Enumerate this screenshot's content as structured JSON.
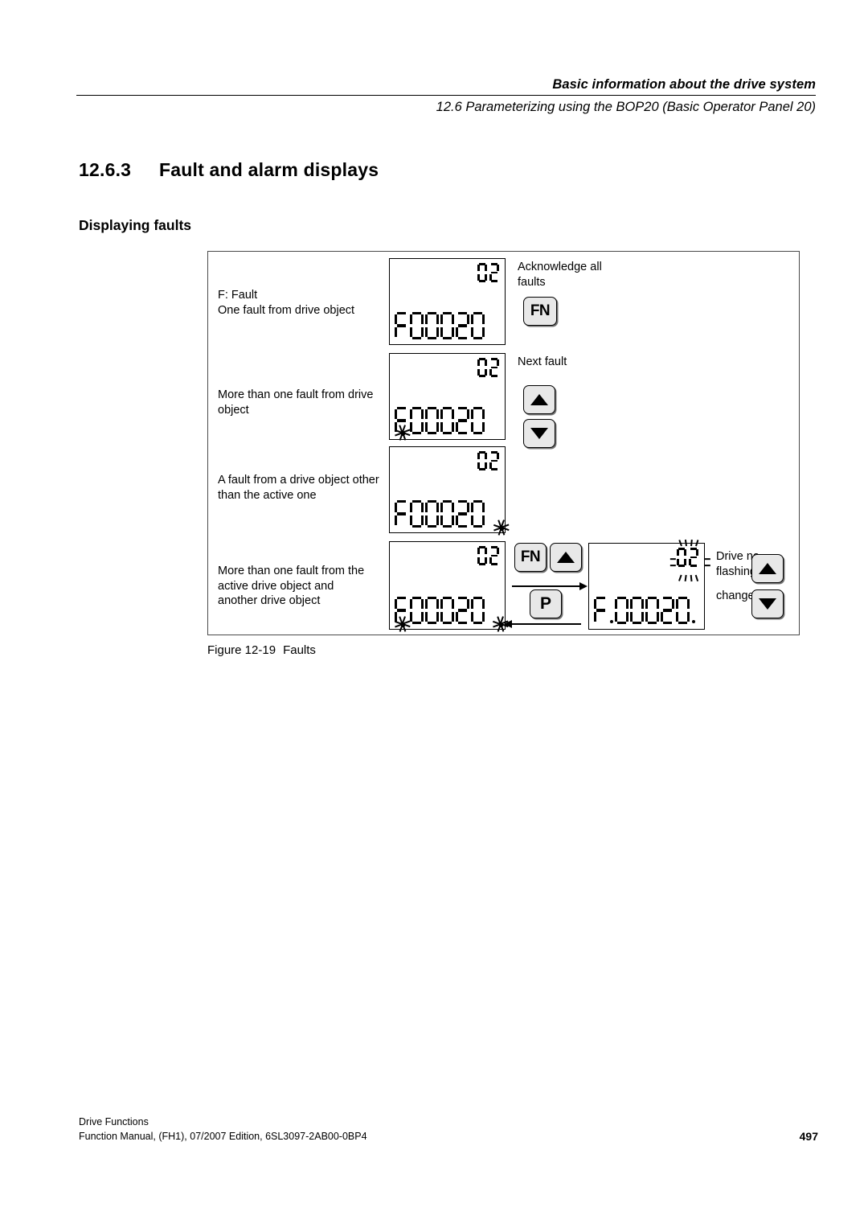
{
  "header": {
    "line1": "Basic information about the drive system",
    "line2": "12.6 Parameterizing using the BOP20 (Basic Operator Panel 20)"
  },
  "section": {
    "number": "12.6.3",
    "title": "Fault and alarm displays",
    "subtitle": "Displaying faults"
  },
  "figure": {
    "caption_label": "Figure 12-19",
    "caption_text": "Faults",
    "rows": [
      {
        "label_line1": "F: Fault",
        "label_line2": "One fault from drive object",
        "display_small": "02",
        "display_main": "F00020",
        "note_line1": "Acknowledge all",
        "note_line2": "faults",
        "keys": [
          "FN"
        ]
      },
      {
        "label_line1": "More than one fault from drive",
        "label_line2": "object",
        "display_small": "02",
        "display_main": "F00020",
        "note_line1": "Next fault",
        "note_line2": "",
        "keys": [
          "up",
          "down"
        ]
      },
      {
        "label_line1": "A fault from a drive object other",
        "label_line2": "than the active one",
        "display_small": "02",
        "display_main": "F00020",
        "note_line1": "",
        "note_line2": "",
        "keys": []
      },
      {
        "label_line1": "More than one fault from the",
        "label_line2": "active drive object and",
        "label_line3": "another drive object",
        "display_small": "02",
        "display_main": "F00020",
        "display2_small": "02",
        "display2_main": "F00020",
        "note_line1": "Drive no.",
        "note_line2": "flashing",
        "note_line3": "change",
        "keys_mid": [
          "FN",
          "up",
          "P"
        ],
        "keys_right": [
          "up",
          "down"
        ]
      }
    ]
  },
  "footer": {
    "line1": "Drive Functions",
    "line2": "Function Manual, (FH1), 07/2007 Edition, 6SL3097-2AB00-0BP4",
    "page": "497"
  }
}
